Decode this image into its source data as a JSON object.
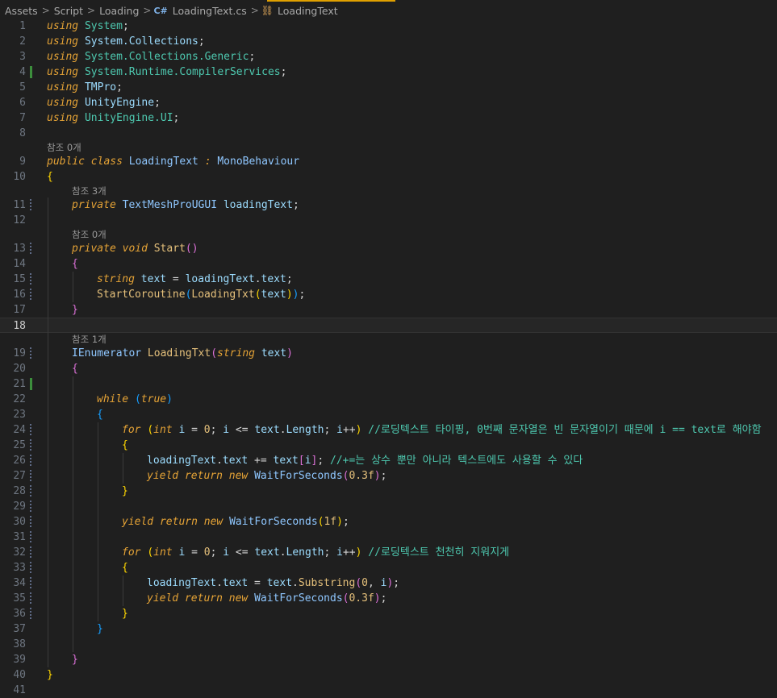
{
  "breadcrumb": {
    "items": [
      "Assets",
      "Script",
      "Loading",
      "LoadingText.cs",
      "LoadingText"
    ],
    "separator": ">"
  },
  "editor": {
    "active_line": 18,
    "lens": {
      "class_refs": "참조 0개",
      "field_refs": "참조 3개",
      "start_refs": "참조 0개",
      "coroutine_refs": "참조 1개"
    },
    "lines": [
      {
        "n": "1",
        "indent": 0,
        "t": [
          [
            "kwi",
            "using"
          ],
          [
            "pl",
            " "
          ],
          [
            "ty",
            "System"
          ],
          [
            "pl",
            ";"
          ]
        ]
      },
      {
        "n": "2",
        "indent": 0,
        "t": [
          [
            "kwi",
            "using"
          ],
          [
            "pl",
            " "
          ],
          [
            "vr",
            "System.Collections"
          ],
          [
            "pl",
            ";"
          ]
        ]
      },
      {
        "n": "3",
        "indent": 0,
        "t": [
          [
            "kwi",
            "using"
          ],
          [
            "pl",
            " "
          ],
          [
            "ty",
            "System.Collections.Generic"
          ],
          [
            "pl",
            ";"
          ]
        ]
      },
      {
        "n": "4",
        "indent": 0,
        "t": [
          [
            "kwi",
            "using"
          ],
          [
            "pl",
            " "
          ],
          [
            "ty",
            "System.Runtime.CompilerServices"
          ],
          [
            "pl",
            ";"
          ]
        ]
      },
      {
        "n": "5",
        "indent": 0,
        "t": [
          [
            "kwi",
            "using"
          ],
          [
            "pl",
            " "
          ],
          [
            "vr",
            "TMPro"
          ],
          [
            "pl",
            ";"
          ]
        ]
      },
      {
        "n": "6",
        "indent": 0,
        "t": [
          [
            "kwi",
            "using"
          ],
          [
            "pl",
            " "
          ],
          [
            "vr",
            "UnityEngine"
          ],
          [
            "pl",
            ";"
          ]
        ]
      },
      {
        "n": "7",
        "indent": 0,
        "t": [
          [
            "kwi",
            "using"
          ],
          [
            "pl",
            " "
          ],
          [
            "ty",
            "UnityEngine.UI"
          ],
          [
            "pl",
            ";"
          ]
        ]
      },
      {
        "n": "8",
        "indent": 0,
        "t": []
      },
      {
        "lens": "class_refs",
        "indent": 0
      },
      {
        "n": "9",
        "indent": 0,
        "t": [
          [
            "kwi",
            "public"
          ],
          [
            "pl",
            " "
          ],
          [
            "kwi",
            "class"
          ],
          [
            "pl",
            " "
          ],
          [
            "tyb",
            "LoadingText"
          ],
          [
            "pl",
            " "
          ],
          [
            "kwi",
            ":"
          ],
          [
            "pl",
            " "
          ],
          [
            "tyb",
            "MonoBehaviour"
          ]
        ]
      },
      {
        "n": "10",
        "indent": 0,
        "t": [
          [
            "br1",
            "{"
          ]
        ]
      },
      {
        "lens": "field_refs",
        "indent": 1
      },
      {
        "n": "11",
        "indent": 1,
        "t": [
          [
            "kwi",
            "private"
          ],
          [
            "pl",
            " "
          ],
          [
            "tyb",
            "TextMeshProUGUI"
          ],
          [
            "pl",
            " "
          ],
          [
            "vr",
            "loadingText"
          ],
          [
            "pl",
            ";"
          ]
        ]
      },
      {
        "n": "12",
        "indent": 0,
        "t": []
      },
      {
        "lens": "start_refs",
        "indent": 1
      },
      {
        "n": "13",
        "indent": 1,
        "t": [
          [
            "kwi",
            "private"
          ],
          [
            "pl",
            " "
          ],
          [
            "kwi",
            "void"
          ],
          [
            "pl",
            " "
          ],
          [
            "fnb",
            "Start"
          ],
          [
            "br2",
            "()"
          ]
        ]
      },
      {
        "n": "14",
        "indent": 1,
        "t": [
          [
            "br2",
            "{"
          ]
        ]
      },
      {
        "n": "15",
        "indent": 2,
        "t": [
          [
            "kwi",
            "string"
          ],
          [
            "pl",
            " "
          ],
          [
            "vr",
            "text"
          ],
          [
            "pl",
            " = "
          ],
          [
            "vr",
            "loadingText"
          ],
          [
            "pl",
            "."
          ],
          [
            "vr",
            "text"
          ],
          [
            "pl",
            ";"
          ]
        ]
      },
      {
        "n": "16",
        "indent": 2,
        "t": [
          [
            "fnb",
            "StartCoroutine"
          ],
          [
            "br3",
            "("
          ],
          [
            "fnb",
            "LoadingTxt"
          ],
          [
            "br1",
            "("
          ],
          [
            "vr",
            "text"
          ],
          [
            "br1",
            ")"
          ],
          [
            "br3",
            ")"
          ],
          [
            "pl",
            ";"
          ]
        ]
      },
      {
        "n": "17",
        "indent": 1,
        "t": [
          [
            "br2",
            "}"
          ]
        ]
      },
      {
        "n": "18",
        "indent": 0,
        "t": []
      },
      {
        "lens": "coroutine_refs",
        "indent": 1
      },
      {
        "n": "19",
        "indent": 1,
        "t": [
          [
            "tyb",
            "IEnumerator"
          ],
          [
            "pl",
            " "
          ],
          [
            "fnb",
            "LoadingTxt"
          ],
          [
            "br2",
            "("
          ],
          [
            "kwi",
            "string"
          ],
          [
            "pl",
            " "
          ],
          [
            "vr",
            "text"
          ],
          [
            "br2",
            ")"
          ]
        ]
      },
      {
        "n": "20",
        "indent": 1,
        "t": [
          [
            "br2",
            "{"
          ]
        ]
      },
      {
        "n": "21",
        "indent": 0,
        "t": []
      },
      {
        "n": "22",
        "indent": 2,
        "t": [
          [
            "ctl",
            "while"
          ],
          [
            "pl",
            " "
          ],
          [
            "br3",
            "("
          ],
          [
            "ctl",
            "true"
          ],
          [
            "br3",
            ")"
          ]
        ]
      },
      {
        "n": "23",
        "indent": 2,
        "t": [
          [
            "br3",
            "{"
          ]
        ]
      },
      {
        "n": "24",
        "indent": 3,
        "t": [
          [
            "ctl",
            "for"
          ],
          [
            "pl",
            " "
          ],
          [
            "br1",
            "("
          ],
          [
            "kwi",
            "int"
          ],
          [
            "pl",
            " "
          ],
          [
            "vr",
            "i"
          ],
          [
            "pl",
            " = "
          ],
          [
            "nm",
            "0"
          ],
          [
            "pl",
            "; "
          ],
          [
            "vr",
            "i"
          ],
          [
            "pl",
            " <= "
          ],
          [
            "vr",
            "text"
          ],
          [
            "pl",
            "."
          ],
          [
            "vr",
            "Length"
          ],
          [
            "pl",
            "; "
          ],
          [
            "vr",
            "i"
          ],
          [
            "pl",
            "++"
          ],
          [
            "br1",
            ")"
          ],
          [
            "pl",
            " "
          ],
          [
            "cm",
            "//로딩텍스트 타이핑, 0번째 문자열은 빈 문자열이기 때문에 i == text로 해야함"
          ]
        ]
      },
      {
        "n": "25",
        "indent": 3,
        "t": [
          [
            "br1",
            "{"
          ]
        ]
      },
      {
        "n": "26",
        "indent": 4,
        "t": [
          [
            "vr",
            "loadingText"
          ],
          [
            "pl",
            "."
          ],
          [
            "vr",
            "text"
          ],
          [
            "pl",
            " += "
          ],
          [
            "vr",
            "text"
          ],
          [
            "br2",
            "["
          ],
          [
            "vr",
            "i"
          ],
          [
            "br2",
            "]"
          ],
          [
            "pl",
            "; "
          ],
          [
            "cm",
            "//+=는 상수 뿐만 아니라 텍스트에도 사용할 수 있다"
          ]
        ]
      },
      {
        "n": "27",
        "indent": 4,
        "t": [
          [
            "ctl",
            "yield"
          ],
          [
            "pl",
            " "
          ],
          [
            "ctl",
            "return"
          ],
          [
            "pl",
            " "
          ],
          [
            "ctl",
            "new"
          ],
          [
            "pl",
            " "
          ],
          [
            "tyb",
            "WaitForSeconds"
          ],
          [
            "br2",
            "("
          ],
          [
            "nm",
            "0.3f"
          ],
          [
            "br2",
            ")"
          ],
          [
            "pl",
            ";"
          ]
        ]
      },
      {
        "n": "28",
        "indent": 3,
        "t": [
          [
            "br1",
            "}"
          ]
        ]
      },
      {
        "n": "29",
        "indent": 0,
        "t": []
      },
      {
        "n": "30",
        "indent": 3,
        "t": [
          [
            "ctl",
            "yield"
          ],
          [
            "pl",
            " "
          ],
          [
            "ctl",
            "return"
          ],
          [
            "pl",
            " "
          ],
          [
            "ctl",
            "new"
          ],
          [
            "pl",
            " "
          ],
          [
            "tyb",
            "WaitForSeconds"
          ],
          [
            "br1",
            "("
          ],
          [
            "nm",
            "1f"
          ],
          [
            "br1",
            ")"
          ],
          [
            "pl",
            ";"
          ]
        ]
      },
      {
        "n": "31",
        "indent": 0,
        "t": []
      },
      {
        "n": "32",
        "indent": 3,
        "t": [
          [
            "ctl",
            "for"
          ],
          [
            "pl",
            " "
          ],
          [
            "br1",
            "("
          ],
          [
            "kwi",
            "int"
          ],
          [
            "pl",
            " "
          ],
          [
            "vr",
            "i"
          ],
          [
            "pl",
            " = "
          ],
          [
            "nm",
            "0"
          ],
          [
            "pl",
            "; "
          ],
          [
            "vr",
            "i"
          ],
          [
            "pl",
            " <= "
          ],
          [
            "vr",
            "text"
          ],
          [
            "pl",
            "."
          ],
          [
            "vr",
            "Length"
          ],
          [
            "pl",
            "; "
          ],
          [
            "vr",
            "i"
          ],
          [
            "pl",
            "++"
          ],
          [
            "br1",
            ")"
          ],
          [
            "pl",
            " "
          ],
          [
            "cm",
            "//로딩텍스트 천천히 지워지게"
          ]
        ]
      },
      {
        "n": "33",
        "indent": 3,
        "t": [
          [
            "br1",
            "{"
          ]
        ]
      },
      {
        "n": "34",
        "indent": 4,
        "t": [
          [
            "vr",
            "loadingText"
          ],
          [
            "pl",
            "."
          ],
          [
            "vr",
            "text"
          ],
          [
            "pl",
            " = "
          ],
          [
            "vr",
            "text"
          ],
          [
            "pl",
            "."
          ],
          [
            "fnb",
            "Substring"
          ],
          [
            "br2",
            "("
          ],
          [
            "nm",
            "0"
          ],
          [
            "pl",
            ", "
          ],
          [
            "vr",
            "i"
          ],
          [
            "br2",
            ")"
          ],
          [
            "pl",
            ";"
          ]
        ]
      },
      {
        "n": "35",
        "indent": 4,
        "t": [
          [
            "ctl",
            "yield"
          ],
          [
            "pl",
            " "
          ],
          [
            "ctl",
            "return"
          ],
          [
            "pl",
            " "
          ],
          [
            "ctl",
            "new"
          ],
          [
            "pl",
            " "
          ],
          [
            "tyb",
            "WaitForSeconds"
          ],
          [
            "br2",
            "("
          ],
          [
            "nm",
            "0.3f"
          ],
          [
            "br2",
            ")"
          ],
          [
            "pl",
            ";"
          ]
        ]
      },
      {
        "n": "36",
        "indent": 3,
        "t": [
          [
            "br1",
            "}"
          ]
        ]
      },
      {
        "n": "37",
        "indent": 2,
        "t": [
          [
            "br3",
            "}"
          ]
        ]
      },
      {
        "n": "38",
        "indent": 0,
        "t": []
      },
      {
        "n": "39",
        "indent": 1,
        "t": [
          [
            "br2",
            "}"
          ]
        ]
      },
      {
        "n": "40",
        "indent": 0,
        "t": [
          [
            "br1",
            "}"
          ]
        ]
      },
      {
        "n": "41",
        "indent": 0,
        "t": []
      }
    ]
  }
}
